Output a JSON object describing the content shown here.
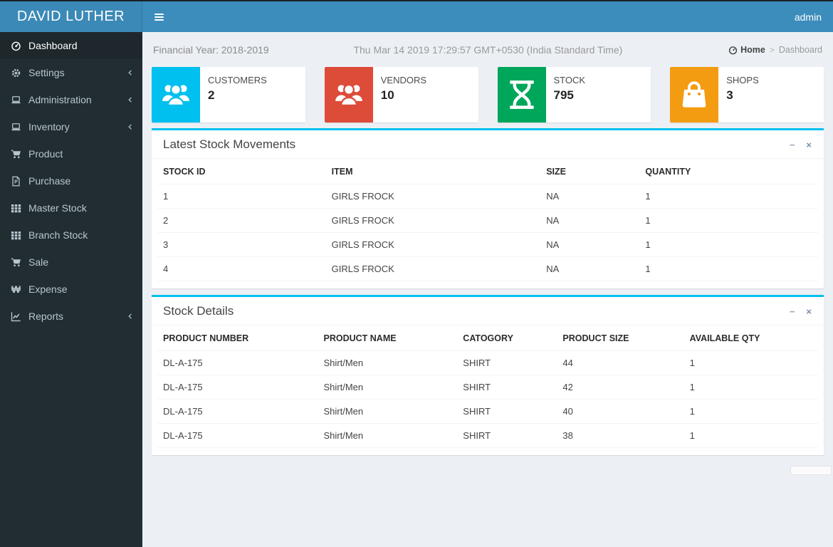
{
  "header": {
    "brand": "DAVID LUTHER",
    "user": "admin"
  },
  "sidebar": {
    "items": [
      {
        "label": "Dashboard",
        "icon": "dashboard-icon",
        "active": true,
        "expandable": false
      },
      {
        "label": "Settings",
        "icon": "gear-icon",
        "active": false,
        "expandable": true
      },
      {
        "label": "Administration",
        "icon": "laptop-icon",
        "active": false,
        "expandable": true
      },
      {
        "label": "Inventory",
        "icon": "laptop-icon",
        "active": false,
        "expandable": true
      },
      {
        "label": "Product",
        "icon": "cart-icon",
        "active": false,
        "expandable": false
      },
      {
        "label": "Purchase",
        "icon": "file-p-icon",
        "active": false,
        "expandable": false
      },
      {
        "label": "Master Stock",
        "icon": "grid-icon",
        "active": false,
        "expandable": false
      },
      {
        "label": "Branch Stock",
        "icon": "grid-icon",
        "active": false,
        "expandable": false
      },
      {
        "label": "Sale",
        "icon": "cart-icon",
        "active": false,
        "expandable": false
      },
      {
        "label": "Expense",
        "icon": "won-icon",
        "active": false,
        "expandable": false
      },
      {
        "label": "Reports",
        "icon": "chart-line-icon",
        "active": false,
        "expandable": true
      }
    ]
  },
  "content_header": {
    "financial_year": "Financial Year: 2018-2019",
    "datetime": "Thu Mar 14 2019 17:29:57 GMT+0530 (India Standard Time)",
    "breadcrumb": {
      "home": "Home",
      "separator": ">",
      "current": "Dashboard"
    }
  },
  "info_boxes": [
    {
      "label": "CUSTOMERS",
      "value": "2",
      "color": "#00c0ef",
      "icon": "users-icon"
    },
    {
      "label": "VENDORS",
      "value": "10",
      "color": "#dd4b39",
      "icon": "users-icon"
    },
    {
      "label": "STOCK",
      "value": "795",
      "color": "#00a65a",
      "icon": "hourglass-icon"
    },
    {
      "label": "SHOPS",
      "value": "3",
      "color": "#f39c12",
      "icon": "shopping-bag-icon"
    }
  ],
  "panels": [
    {
      "title": "Latest Stock Movements",
      "tools": {
        "collapse": "−",
        "close": "×"
      },
      "columns": [
        "STOCK ID",
        "ITEM",
        "SIZE",
        "QUANTITY"
      ],
      "rows": [
        [
          "1",
          "GIRLS FROCK",
          "NA",
          "1"
        ],
        [
          "2",
          "GIRLS FROCK",
          "NA",
          "1"
        ],
        [
          "3",
          "GIRLS FROCK",
          "NA",
          "1"
        ],
        [
          "4",
          "GIRLS FROCK",
          "NA",
          "1"
        ]
      ]
    },
    {
      "title": "Stock Details",
      "tools": {
        "collapse": "−",
        "close": "×"
      },
      "columns": [
        "PRODUCT NUMBER",
        "PRODUCT NAME",
        "CATOGORY",
        "PRODUCT SIZE",
        "AVAILABLE QTY"
      ],
      "rows": [
        [
          "DL-A-175",
          "Shirt/Men",
          "SHIRT",
          "44",
          "1"
        ],
        [
          "DL-A-175",
          "Shirt/Men",
          "SHIRT",
          "42",
          "1"
        ],
        [
          "DL-A-175",
          "Shirt/Men",
          "SHIRT",
          "40",
          "1"
        ],
        [
          "DL-A-175",
          "Shirt/Men",
          "SHIRT",
          "38",
          "1"
        ]
      ]
    }
  ],
  "icons": {
    "won": "₩"
  },
  "theme": {
    "navbar": "#3c8dbc",
    "sidebar": "#222d32",
    "panel_accent": "#00c0ef"
  }
}
